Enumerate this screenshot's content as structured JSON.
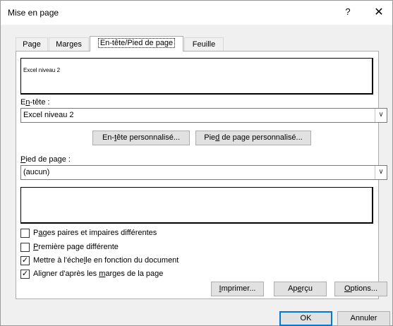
{
  "window": {
    "title": "Mise en page",
    "help_label": "?",
    "close_label": "✕"
  },
  "tabs": [
    {
      "label": "Page",
      "active": false
    },
    {
      "label": "Marges",
      "active": false
    },
    {
      "label": "En-tête/Pied de page",
      "active": true
    },
    {
      "label": "Feuille",
      "active": false
    }
  ],
  "header": {
    "preview_text": "Excel niveau 2",
    "label_pre": "E",
    "label_key": "n",
    "label_post": "-tête :",
    "value": "Excel niveau 2",
    "dropdown_icon": "chevron-down-icon"
  },
  "custom_buttons": {
    "header_pre": "En-",
    "header_key": "t",
    "header_post": "ête personnalisé...",
    "footer_pre": "Pie",
    "footer_key": "d",
    "footer_post": " de page personnalisé..."
  },
  "footer": {
    "label_pre": "",
    "label_key": "P",
    "label_post": "ied de page :",
    "value": "(aucun)",
    "preview_text": ""
  },
  "options": [
    {
      "pre": "P",
      "key": "a",
      "post": "ges paires et impaires différentes",
      "checked": false
    },
    {
      "pre": "",
      "key": "P",
      "post": "remière page différente",
      "checked": false
    },
    {
      "pre": "Mettre à l'éche",
      "key": "l",
      "post": "le en fonction du document",
      "checked": true
    },
    {
      "pre": "Aligner d'après les ",
      "key": "m",
      "post": "arges de la page",
      "checked": true
    }
  ],
  "action_buttons": {
    "print_key": "I",
    "print_post": "mprimer...",
    "preview_pre": "Ap",
    "preview_key": "e",
    "preview_post": "rçu",
    "options_key": "O",
    "options_post": "ptions..."
  },
  "footer_buttons": {
    "ok": "OK",
    "cancel": "Annuler"
  },
  "colors": {
    "accent": "#0078d7"
  }
}
